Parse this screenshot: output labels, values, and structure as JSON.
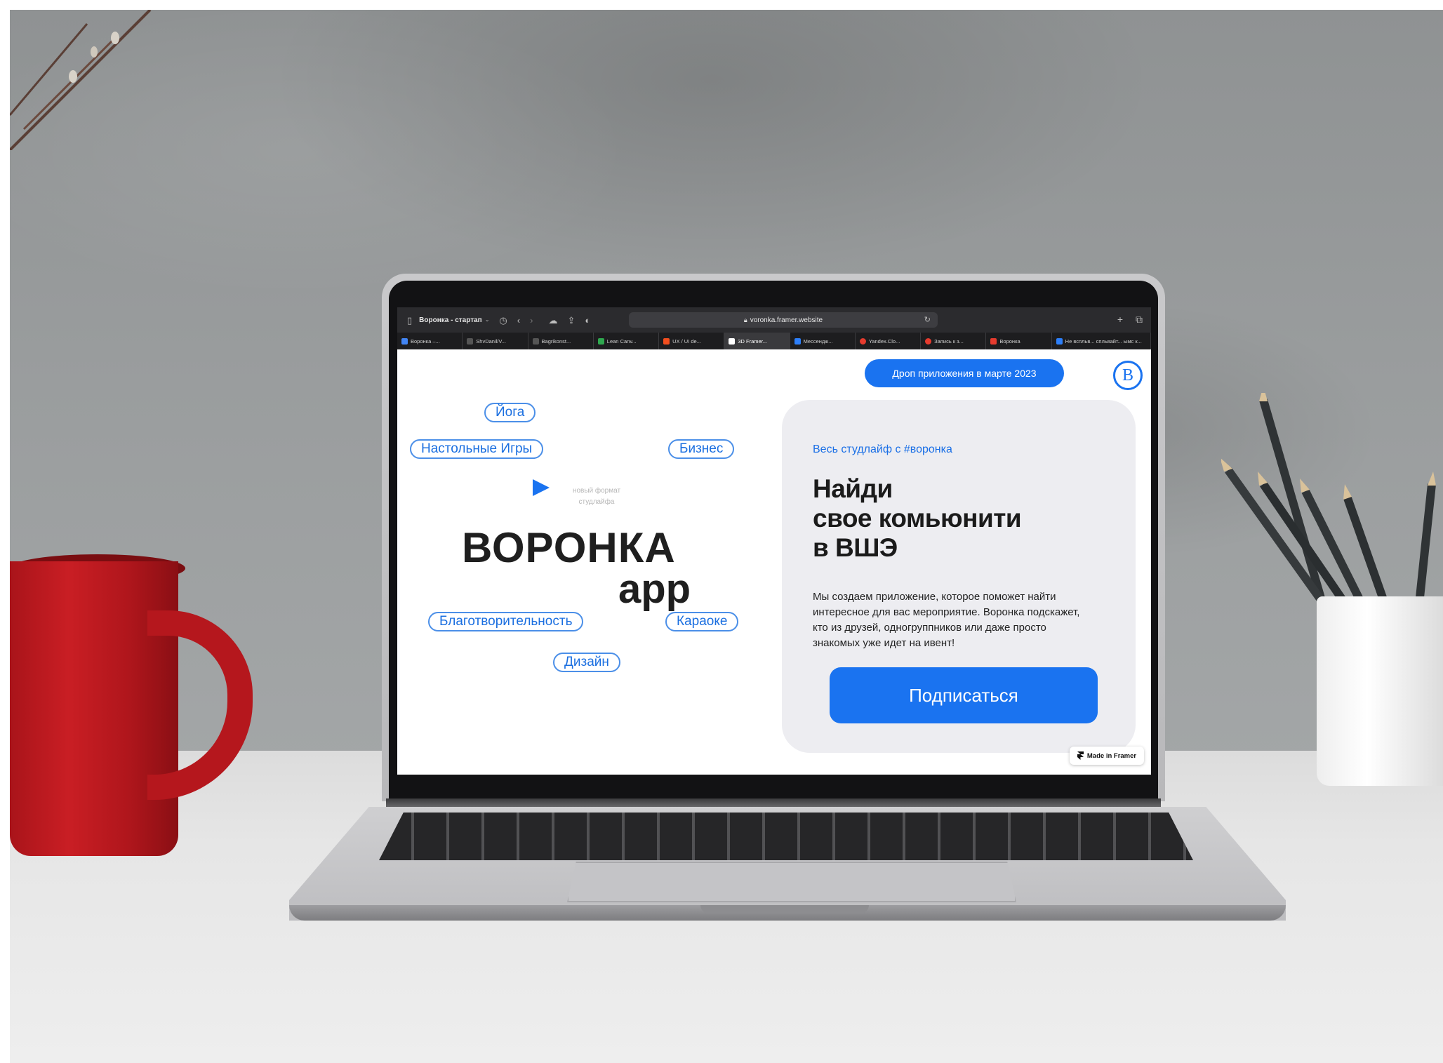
{
  "browser": {
    "window_title": "Воронка - стартап",
    "url": "voronka.framer.website",
    "tabs": [
      {
        "label": "Воронка –...",
        "color": "#4285f4"
      },
      {
        "label": "ShvDanil/V...",
        "color": "#555555"
      },
      {
        "label": "Bagrikonst...",
        "color": "#555555"
      },
      {
        "label": "Lean Canv...",
        "color": "#2fa84f"
      },
      {
        "label": "UX / UI de...",
        "color": "#f24e1e"
      },
      {
        "label": "3D Framer...",
        "color": "#ffffff"
      },
      {
        "label": "Мессендж...",
        "color": "#2d7ff9"
      },
      {
        "label": "Yandex.Clo...",
        "color": "#e63b2e"
      },
      {
        "label": "Запись к з...",
        "color": "#e63b2e"
      },
      {
        "label": "Воронка",
        "color": "#e63b2e"
      },
      {
        "label": "Не вспльв... спльвайт... ымс к...",
        "color": "#2d7ff9"
      }
    ]
  },
  "hero": {
    "tags": {
      "yoga": "Йога",
      "board_games": "Настольные Игры",
      "business": "Бизнес",
      "charity": "Благотворительность",
      "karaoke": "Караоке",
      "design": "Дизайн"
    },
    "note_line1": "новый формат",
    "note_line2": "студлайфа",
    "logo_line1": "ВОРОНКА",
    "logo_line2": "app"
  },
  "card": {
    "drop_pill": "Дроп приложения в марте 2023",
    "hse_logo_letter": "В",
    "tagline": "Весь студлайф с #воронка",
    "title_line1": "Найди",
    "title_line2": "свое комьюнити",
    "title_line3": "в ВШЭ",
    "description": "Мы создаем приложение, которое поможет найти интересное для вас мероприятие. Воронка подскажет, кто из друзей, одногруппников или даже просто знакомых уже идет на ивент!",
    "subscribe_label": "Подписаться"
  },
  "framer_badge": "Made in Framer",
  "colors": {
    "accent": "#1a73f0",
    "card_bg": "#ededf1",
    "text_dark": "#1b1b1b"
  }
}
